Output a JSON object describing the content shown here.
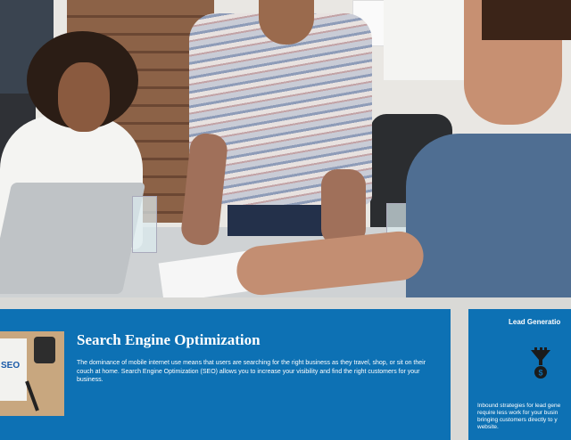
{
  "hero": {
    "image_description_icon": "team-meeting-photo"
  },
  "seo_card": {
    "title": "Search Engine Optimization",
    "description": "The dominance of mobile internet use means that users are searching for the right business as they travel, shop, or sit on their couch at home. Search Engine Optimization (SEO) allows you to increase your visibility and find the right customers for your business.",
    "thumbnail_icon": "seo-notebook-thumbnail",
    "thumbnail_text": "SEO"
  },
  "lead_card": {
    "title": "Lead Generatio",
    "icon": "funnel-dollar-icon",
    "line1": "Inbound strategies for lead gene",
    "line2": "require less work for your busin",
    "line3": "bringing customers directly to y",
    "line4": "website."
  },
  "colors": {
    "card_blue": "#0d71b4",
    "background": "#d9d9d6"
  }
}
